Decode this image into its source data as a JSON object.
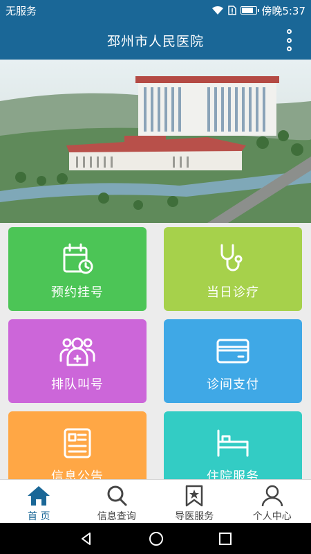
{
  "status_bar": {
    "carrier": "无服务",
    "time": "傍晚5:37",
    "battery_level": 0.85
  },
  "header": {
    "title": "邳州市人民医院"
  },
  "tiles": [
    {
      "label": "预约挂号",
      "icon": "calendar-clock-icon",
      "color": "#4cc556"
    },
    {
      "label": "当日诊疗",
      "icon": "stethoscope-icon",
      "color": "#a6d14b"
    },
    {
      "label": "排队叫号",
      "icon": "queue-people-icon",
      "color": "#cc66d9"
    },
    {
      "label": "诊间支付",
      "icon": "card-icon",
      "color": "#3fa8e6"
    },
    {
      "label": "信息公告",
      "icon": "notice-icon",
      "color": "#ffa745"
    },
    {
      "label": "住院服务",
      "icon": "bed-icon",
      "color": "#33ccc4"
    }
  ],
  "bottom_nav": [
    {
      "label": "首 页",
      "icon": "home-icon",
      "active": true
    },
    {
      "label": "信息查询",
      "icon": "search-icon",
      "active": false
    },
    {
      "label": "导医服务",
      "icon": "bookmark-star-icon",
      "active": false
    },
    {
      "label": "个人中心",
      "icon": "person-icon",
      "active": false
    }
  ],
  "colors": {
    "brand": "#1a6797",
    "active_tab": "#1a6797"
  }
}
